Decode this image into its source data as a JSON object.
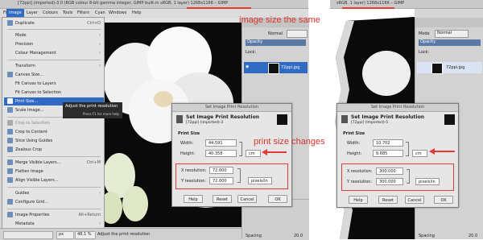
{
  "left": {
    "title": "[72ppi] (imported)-3.0 (RGB colour 8-bit gamma integer, GIMP built-in sRGB, 1 layer) 1268x1166 – GIMP",
    "menubar": [
      "File",
      "Edit",
      "Select",
      "View",
      "Image",
      "Layer",
      "Colours",
      "Tools",
      "Filters",
      "Cyan",
      "Windows",
      "Help"
    ],
    "image_menu": [
      {
        "label": "Duplicate",
        "shortcut": "Ctrl+D"
      },
      {
        "label": "Mode",
        "arrow": true
      },
      {
        "label": "Precision",
        "arrow": true
      },
      {
        "label": "Colour Management",
        "arrow": true
      },
      {
        "label": "Transform",
        "arrow": true
      },
      {
        "label": "Canvas Size..."
      },
      {
        "label": "Fit Canvas to Layers"
      },
      {
        "label": "Fit Canvas to Selection"
      },
      {
        "label": "Print Size...",
        "selected": true
      },
      {
        "label": "Scale Image..."
      },
      {
        "label": "Crop to Selection",
        "disabled": true
      },
      {
        "label": "Crop to Content"
      },
      {
        "label": "Slice Using Guides"
      },
      {
        "label": "Zealous Crop"
      },
      {
        "label": "Merge Visible Layers...",
        "shortcut": "Ctrl+M"
      },
      {
        "label": "Flatten Image"
      },
      {
        "label": "Align Visible Layers..."
      },
      {
        "label": "Guides",
        "arrow": true
      },
      {
        "label": "Configure Grid..."
      },
      {
        "label": "Image Properties",
        "shortcut": "Alt+Return"
      },
      {
        "label": "Metadata",
        "arrow": true
      }
    ],
    "tooltip": {
      "text": "Adjust the print resolution",
      "help": "Press F1 for more help"
    },
    "statusbar": {
      "unit": "px",
      "zoom": "48.1 %",
      "message": "Adjust the print resolution"
    },
    "layers": {
      "mode": "Normal",
      "opacity": "Opacity",
      "lock": "Lock:",
      "layer_name": "72ppi.jpg",
      "spacing": "Spacing",
      "spacing_value": "20.0"
    },
    "dialog": {
      "title": "Set Image Print Resolution",
      "heading": "Set Image Print Resolution",
      "subheading": "[72ppi] (imported)-3",
      "section": "Print Size",
      "width_label": "Width:",
      "width_value": "44.591",
      "height_label": "Height:",
      "height_value": "40.358",
      "unit": "cm",
      "xres_label": "X resolution:",
      "xres_value": "72.000",
      "yres_label": "Y resolution:",
      "yres_value": "72.000",
      "res_unit": "pixels/in",
      "buttons": [
        "Help",
        "Reset",
        "Cancel",
        "OK"
      ]
    }
  },
  "right": {
    "title": "sRGB, 1 layer) 1268x1166 – GIMP",
    "layers": {
      "mode": "Mode",
      "mode_value": "Normal",
      "opacity": "Opacity",
      "lock": "Lock:",
      "layer_name": "72ppi.jpg",
      "spacing": "Spacing",
      "spacing_value": "20.0"
    },
    "dialog": {
      "title": "Set Image Print Resolution",
      "heading": "Set Image Print Resolution",
      "subheading": "[72ppi] (imported)-5",
      "section": "Print Size",
      "width_label": "Width:",
      "width_value": "10.702",
      "height_label": "Height:",
      "height_value": "9.685",
      "unit": "cm",
      "xres_label": "X resolution:",
      "xres_value": "300.000",
      "yres_label": "Y resolution:",
      "yres_value": "300.000",
      "res_unit": "pixels/in",
      "buttons": [
        "Help",
        "Reset",
        "Cancel",
        "OK"
      ]
    }
  },
  "annotations": {
    "image_size": "image size the same",
    "print_size": "print size changes"
  },
  "colors": {
    "annotation": "#d9342b",
    "highlight": "#2f6bc2"
  }
}
